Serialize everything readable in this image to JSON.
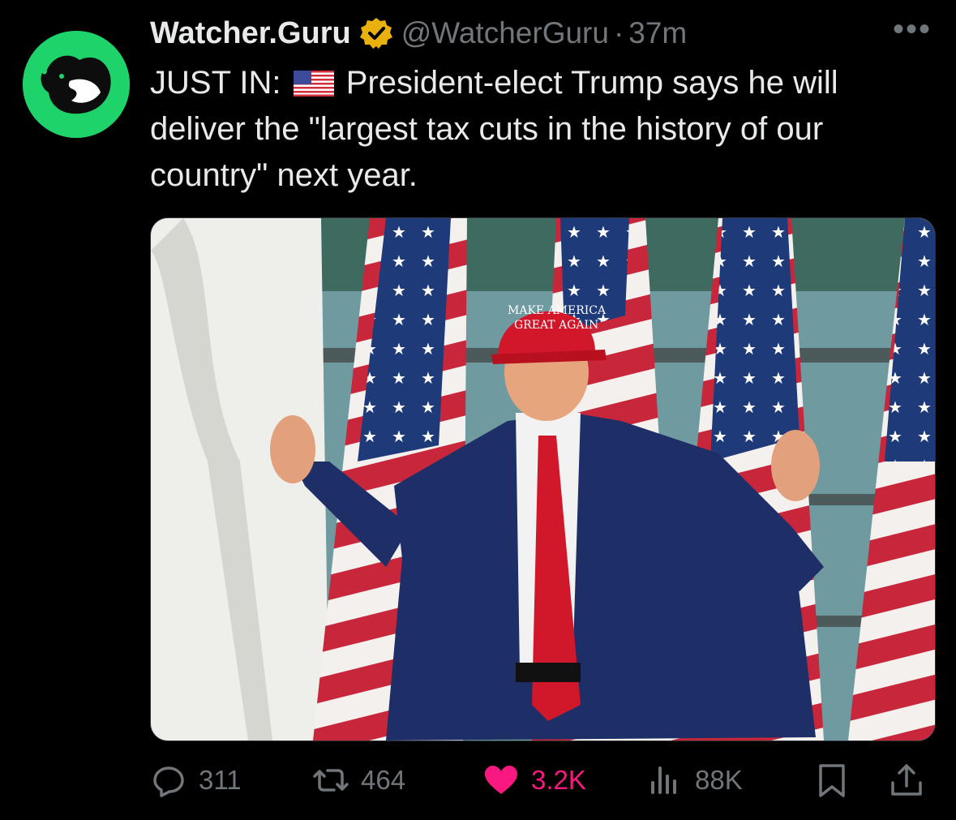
{
  "tweet": {
    "author_name": "Watcher.Guru",
    "handle": "@WatcherGuru",
    "separator": "·",
    "time": "37m",
    "more_label": "•••",
    "text_prefix": "JUST IN:",
    "text_body": "President-elect Trump says he will deliver the \"largest tax cuts in the history of our country\" next year."
  },
  "media": {
    "cap_line1": "MAKE AMERICA",
    "cap_line2": "GREAT AGAIN"
  },
  "actions": {
    "replies": "311",
    "reposts": "464",
    "likes": "3.2K",
    "views": "88K"
  },
  "icons": {
    "avatar": "whale-logo-icon",
    "verified": "verified-badge-icon",
    "flag": "us-flag-emoji",
    "reply": "reply-icon",
    "repost": "repost-icon",
    "like": "heart-icon",
    "views": "views-icon",
    "bookmark": "bookmark-icon",
    "share": "share-icon"
  },
  "colors": {
    "background": "#000000",
    "text": "#e7e9ea",
    "secondary": "#71767b",
    "like": "#f91880",
    "avatar_green": "#1fd36b",
    "verified_gold": "#e8b10e"
  }
}
